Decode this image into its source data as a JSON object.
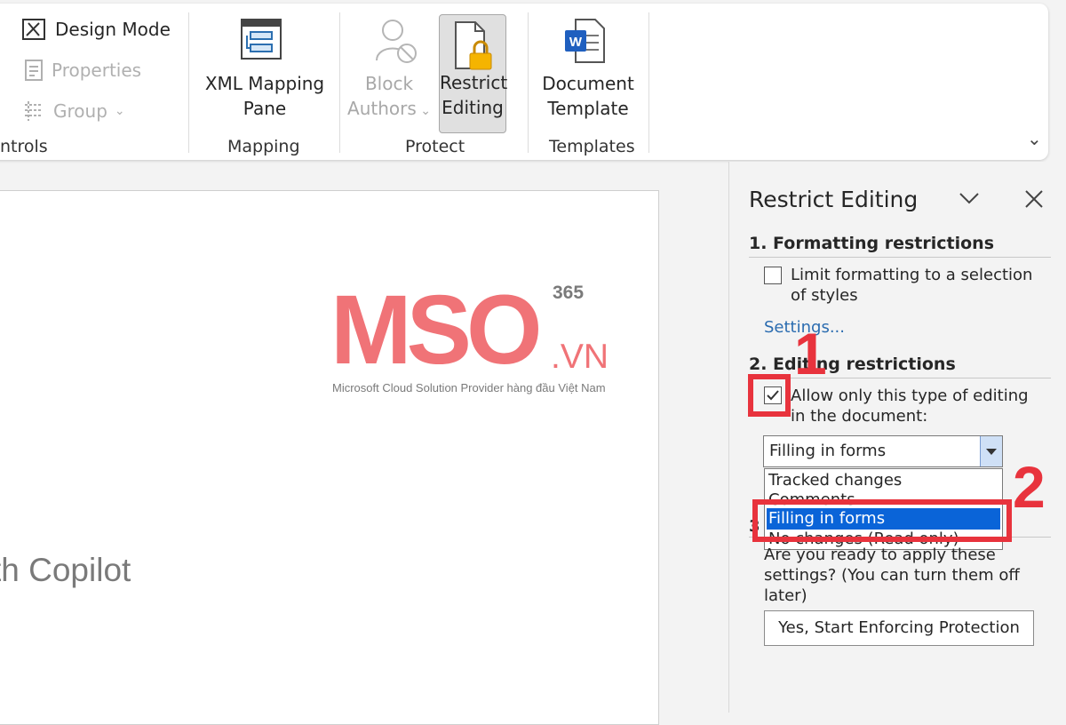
{
  "ribbon": {
    "controls": {
      "design_mode": "Design Mode",
      "properties": "Properties",
      "group": "Group",
      "group_label": "ntrols"
    },
    "mapping": {
      "xml_line1": "XML Mapping",
      "xml_line2": "Pane",
      "group_label": "Mapping"
    },
    "protect": {
      "block_line1": "Block",
      "block_line2": "Authors",
      "restrict_line1": "Restrict",
      "restrict_line2": "Editing",
      "group_label": "Protect"
    },
    "templates": {
      "doc_line1": "Document",
      "doc_line2": "Template",
      "group_label": "Templates"
    }
  },
  "document": {
    "visible_text": "th Copilot"
  },
  "logo": {
    "main": "MSO",
    "superscript": "365",
    "suffix": ".VN",
    "tagline": "Microsoft Cloud Solution Provider hàng đầu Việt Nam"
  },
  "pane": {
    "title": "Restrict Editing",
    "section1": {
      "heading": "1. Formatting restrictions",
      "checkbox_line1": "Limit formatting to a selection",
      "checkbox_line2": "of styles",
      "checked": false,
      "settings_link": "Settings..."
    },
    "section2": {
      "heading": "2. Editing restrictions",
      "checkbox_line1": "Allow only this type of editing",
      "checkbox_line2": "in the document:",
      "checked": true,
      "dropdown_value": "Filling in forms",
      "options": [
        "Tracked changes",
        "Comments",
        "Filling in forms",
        "No changes (Read only)"
      ],
      "selected_option": "Filling in forms"
    },
    "section3": {
      "number": "3",
      "line1": "Are you ready to apply these",
      "line2": "settings? (You can turn them off",
      "line3": "later)",
      "button": "Yes, Start Enforcing Protection"
    }
  },
  "annotations": {
    "step1": "1",
    "step2": "2"
  },
  "colors": {
    "accent_red": "#e8333d",
    "logo_pink": "#f07377",
    "selection_blue": "#0a64d8",
    "link_blue": "#2b6cb0"
  }
}
